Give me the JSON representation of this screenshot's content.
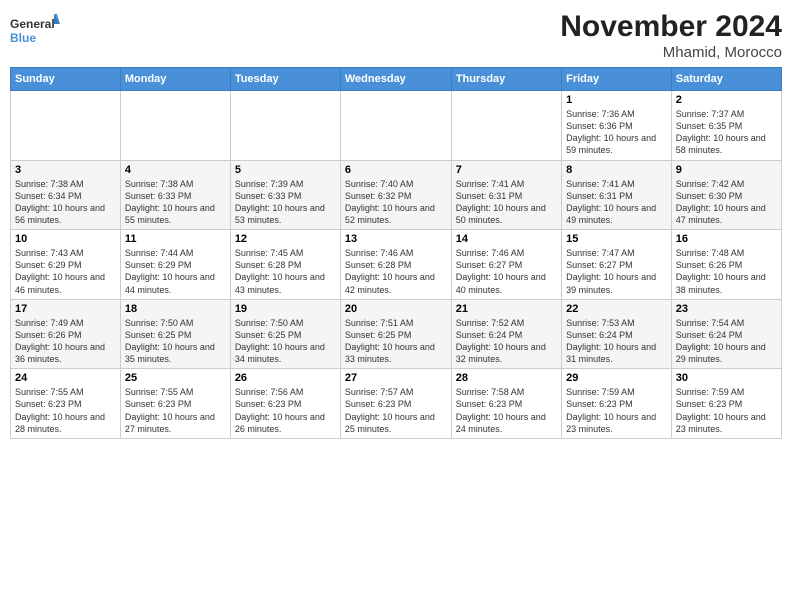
{
  "header": {
    "logo": {
      "general": "General",
      "blue": "Blue"
    },
    "title": "November 2024",
    "location": "Mhamid, Morocco"
  },
  "weekdays": [
    "Sunday",
    "Monday",
    "Tuesday",
    "Wednesday",
    "Thursday",
    "Friday",
    "Saturday"
  ],
  "weeks": [
    [
      {
        "day": "",
        "info": ""
      },
      {
        "day": "",
        "info": ""
      },
      {
        "day": "",
        "info": ""
      },
      {
        "day": "",
        "info": ""
      },
      {
        "day": "",
        "info": ""
      },
      {
        "day": "1",
        "info": "Sunrise: 7:36 AM\nSunset: 6:36 PM\nDaylight: 10 hours and 59 minutes."
      },
      {
        "day": "2",
        "info": "Sunrise: 7:37 AM\nSunset: 6:35 PM\nDaylight: 10 hours and 58 minutes."
      }
    ],
    [
      {
        "day": "3",
        "info": "Sunrise: 7:38 AM\nSunset: 6:34 PM\nDaylight: 10 hours and 56 minutes."
      },
      {
        "day": "4",
        "info": "Sunrise: 7:38 AM\nSunset: 6:33 PM\nDaylight: 10 hours and 55 minutes."
      },
      {
        "day": "5",
        "info": "Sunrise: 7:39 AM\nSunset: 6:33 PM\nDaylight: 10 hours and 53 minutes."
      },
      {
        "day": "6",
        "info": "Sunrise: 7:40 AM\nSunset: 6:32 PM\nDaylight: 10 hours and 52 minutes."
      },
      {
        "day": "7",
        "info": "Sunrise: 7:41 AM\nSunset: 6:31 PM\nDaylight: 10 hours and 50 minutes."
      },
      {
        "day": "8",
        "info": "Sunrise: 7:41 AM\nSunset: 6:31 PM\nDaylight: 10 hours and 49 minutes."
      },
      {
        "day": "9",
        "info": "Sunrise: 7:42 AM\nSunset: 6:30 PM\nDaylight: 10 hours and 47 minutes."
      }
    ],
    [
      {
        "day": "10",
        "info": "Sunrise: 7:43 AM\nSunset: 6:29 PM\nDaylight: 10 hours and 46 minutes."
      },
      {
        "day": "11",
        "info": "Sunrise: 7:44 AM\nSunset: 6:29 PM\nDaylight: 10 hours and 44 minutes."
      },
      {
        "day": "12",
        "info": "Sunrise: 7:45 AM\nSunset: 6:28 PM\nDaylight: 10 hours and 43 minutes."
      },
      {
        "day": "13",
        "info": "Sunrise: 7:46 AM\nSunset: 6:28 PM\nDaylight: 10 hours and 42 minutes."
      },
      {
        "day": "14",
        "info": "Sunrise: 7:46 AM\nSunset: 6:27 PM\nDaylight: 10 hours and 40 minutes."
      },
      {
        "day": "15",
        "info": "Sunrise: 7:47 AM\nSunset: 6:27 PM\nDaylight: 10 hours and 39 minutes."
      },
      {
        "day": "16",
        "info": "Sunrise: 7:48 AM\nSunset: 6:26 PM\nDaylight: 10 hours and 38 minutes."
      }
    ],
    [
      {
        "day": "17",
        "info": "Sunrise: 7:49 AM\nSunset: 6:26 PM\nDaylight: 10 hours and 36 minutes."
      },
      {
        "day": "18",
        "info": "Sunrise: 7:50 AM\nSunset: 6:25 PM\nDaylight: 10 hours and 35 minutes."
      },
      {
        "day": "19",
        "info": "Sunrise: 7:50 AM\nSunset: 6:25 PM\nDaylight: 10 hours and 34 minutes."
      },
      {
        "day": "20",
        "info": "Sunrise: 7:51 AM\nSunset: 6:25 PM\nDaylight: 10 hours and 33 minutes."
      },
      {
        "day": "21",
        "info": "Sunrise: 7:52 AM\nSunset: 6:24 PM\nDaylight: 10 hours and 32 minutes."
      },
      {
        "day": "22",
        "info": "Sunrise: 7:53 AM\nSunset: 6:24 PM\nDaylight: 10 hours and 31 minutes."
      },
      {
        "day": "23",
        "info": "Sunrise: 7:54 AM\nSunset: 6:24 PM\nDaylight: 10 hours and 29 minutes."
      }
    ],
    [
      {
        "day": "24",
        "info": "Sunrise: 7:55 AM\nSunset: 6:23 PM\nDaylight: 10 hours and 28 minutes."
      },
      {
        "day": "25",
        "info": "Sunrise: 7:55 AM\nSunset: 6:23 PM\nDaylight: 10 hours and 27 minutes."
      },
      {
        "day": "26",
        "info": "Sunrise: 7:56 AM\nSunset: 6:23 PM\nDaylight: 10 hours and 26 minutes."
      },
      {
        "day": "27",
        "info": "Sunrise: 7:57 AM\nSunset: 6:23 PM\nDaylight: 10 hours and 25 minutes."
      },
      {
        "day": "28",
        "info": "Sunrise: 7:58 AM\nSunset: 6:23 PM\nDaylight: 10 hours and 24 minutes."
      },
      {
        "day": "29",
        "info": "Sunrise: 7:59 AM\nSunset: 6:23 PM\nDaylight: 10 hours and 23 minutes."
      },
      {
        "day": "30",
        "info": "Sunrise: 7:59 AM\nSunset: 6:23 PM\nDaylight: 10 hours and 23 minutes."
      }
    ]
  ]
}
